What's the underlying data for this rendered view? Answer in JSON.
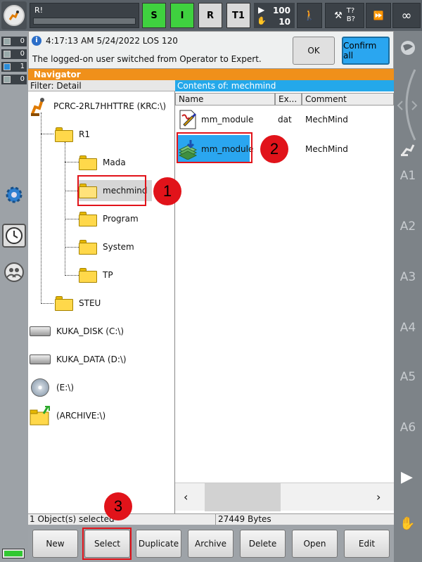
{
  "topbar": {
    "robot_name": "R!",
    "status_s": "S",
    "status_i": "I",
    "status_r": "R",
    "mode": "T1",
    "override_prog": "100",
    "override_jog": "10",
    "coord_top": "T?",
    "coord_bottom": "B?",
    "infinity": "∞"
  },
  "left_counters": [
    "0",
    "0",
    "1",
    "0"
  ],
  "message": {
    "timestamp": "4:17:13 AM 5/24/2022 LOS 120",
    "text": "The logged-on user switched from Operator to Expert.",
    "ok_label": "OK",
    "confirm_all_label": "Confirm all"
  },
  "navigator": {
    "title": "Navigator",
    "filter": "Filter: Detail",
    "tree": {
      "root": "PCRC-2RL7HHTTRE (KRC:\\)",
      "r1": "R1",
      "mada": "Mada",
      "mechmind": "mechmind",
      "program": "Program",
      "system": "System",
      "tp": "TP",
      "steu": "STEU",
      "kuka_disk": "KUKA_DISK (C:\\)",
      "kuka_data": "KUKA_DATA (D:\\)",
      "e_drive": "(E:\\)",
      "archive": "(ARCHIVE:\\)"
    },
    "contents": {
      "title": "Contents of: mechmind",
      "headers": {
        "name": "Name",
        "ext": "Ex...",
        "comment": "Comment"
      },
      "rows": [
        {
          "name": "mm_module",
          "ext": "dat",
          "comment": "MechMind"
        },
        {
          "name": "mm_module",
          "ext": "",
          "comment": "MechMind"
        }
      ]
    }
  },
  "statusbar": {
    "selected": "1 Object(s) selected",
    "bytes": "27449 Bytes"
  },
  "softkeys": [
    "New",
    "Select",
    "Duplicate",
    "Archive",
    "Delete",
    "Open",
    "Edit"
  ],
  "right_axes": [
    "A1",
    "A2",
    "A3",
    "A4",
    "A5",
    "A6"
  ],
  "callouts": [
    "1",
    "2",
    "3"
  ]
}
